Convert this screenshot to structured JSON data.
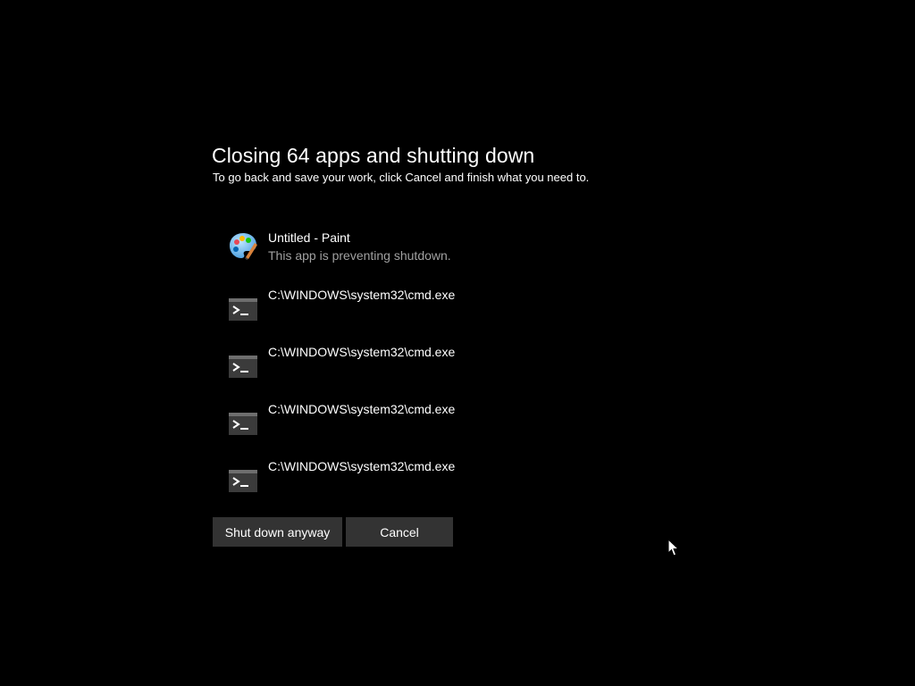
{
  "dialog": {
    "title": "Closing 64 apps and shutting down",
    "subtitle": "To go back and save your work, click Cancel and finish what you need to."
  },
  "apps": [
    {
      "name": "Untitled - Paint",
      "status": "This app is preventing shutdown.",
      "icon": "paint-icon"
    },
    {
      "name": "C:\\WINDOWS\\system32\\cmd.exe",
      "status": "",
      "icon": "cmd-icon"
    },
    {
      "name": "C:\\WINDOWS\\system32\\cmd.exe",
      "status": "",
      "icon": "cmd-icon"
    },
    {
      "name": "C:\\WINDOWS\\system32\\cmd.exe",
      "status": "",
      "icon": "cmd-icon"
    },
    {
      "name": "C:\\WINDOWS\\system32\\cmd.exe",
      "status": "",
      "icon": "cmd-icon"
    }
  ],
  "buttons": {
    "shutdown_label": "Shut down anyway",
    "cancel_label": "Cancel"
  },
  "colors": {
    "background": "#000000",
    "button_bg": "#333333",
    "secondary_text": "#a0a0a0"
  }
}
